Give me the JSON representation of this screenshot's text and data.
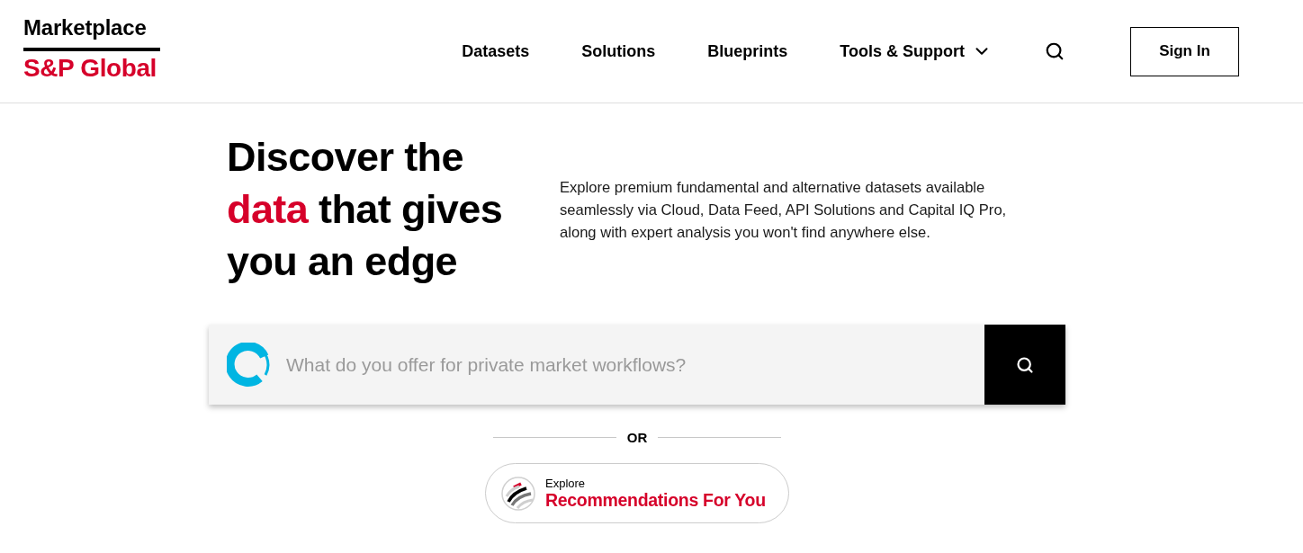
{
  "header": {
    "logo": {
      "title": "Marketplace",
      "wordmark": "S&P Global"
    },
    "nav": [
      {
        "label": "Datasets",
        "kind": "link"
      },
      {
        "label": "Solutions",
        "kind": "link"
      },
      {
        "label": "Blueprints",
        "kind": "link"
      },
      {
        "label": "Tools & Support",
        "kind": "dropdown"
      }
    ],
    "sign_in": "Sign In"
  },
  "hero": {
    "heading": [
      {
        "text": "Discover the ",
        "highlighted": false
      },
      {
        "text": "data",
        "highlighted": true
      },
      {
        "text": " that gives you an edge",
        "highlighted": false
      }
    ],
    "description": "Explore premium fundamental and alternative datasets available seamlessly via Cloud, Data Feed, API Solutions and Capital IQ Pro, along with expert analysis you won't find anywhere else."
  },
  "search": {
    "placeholder": "What do you offer for private market workflows?"
  },
  "divider": {
    "label": "OR"
  },
  "recommendations": {
    "eyebrow": "Explore",
    "title": "Recommendations For You"
  }
}
